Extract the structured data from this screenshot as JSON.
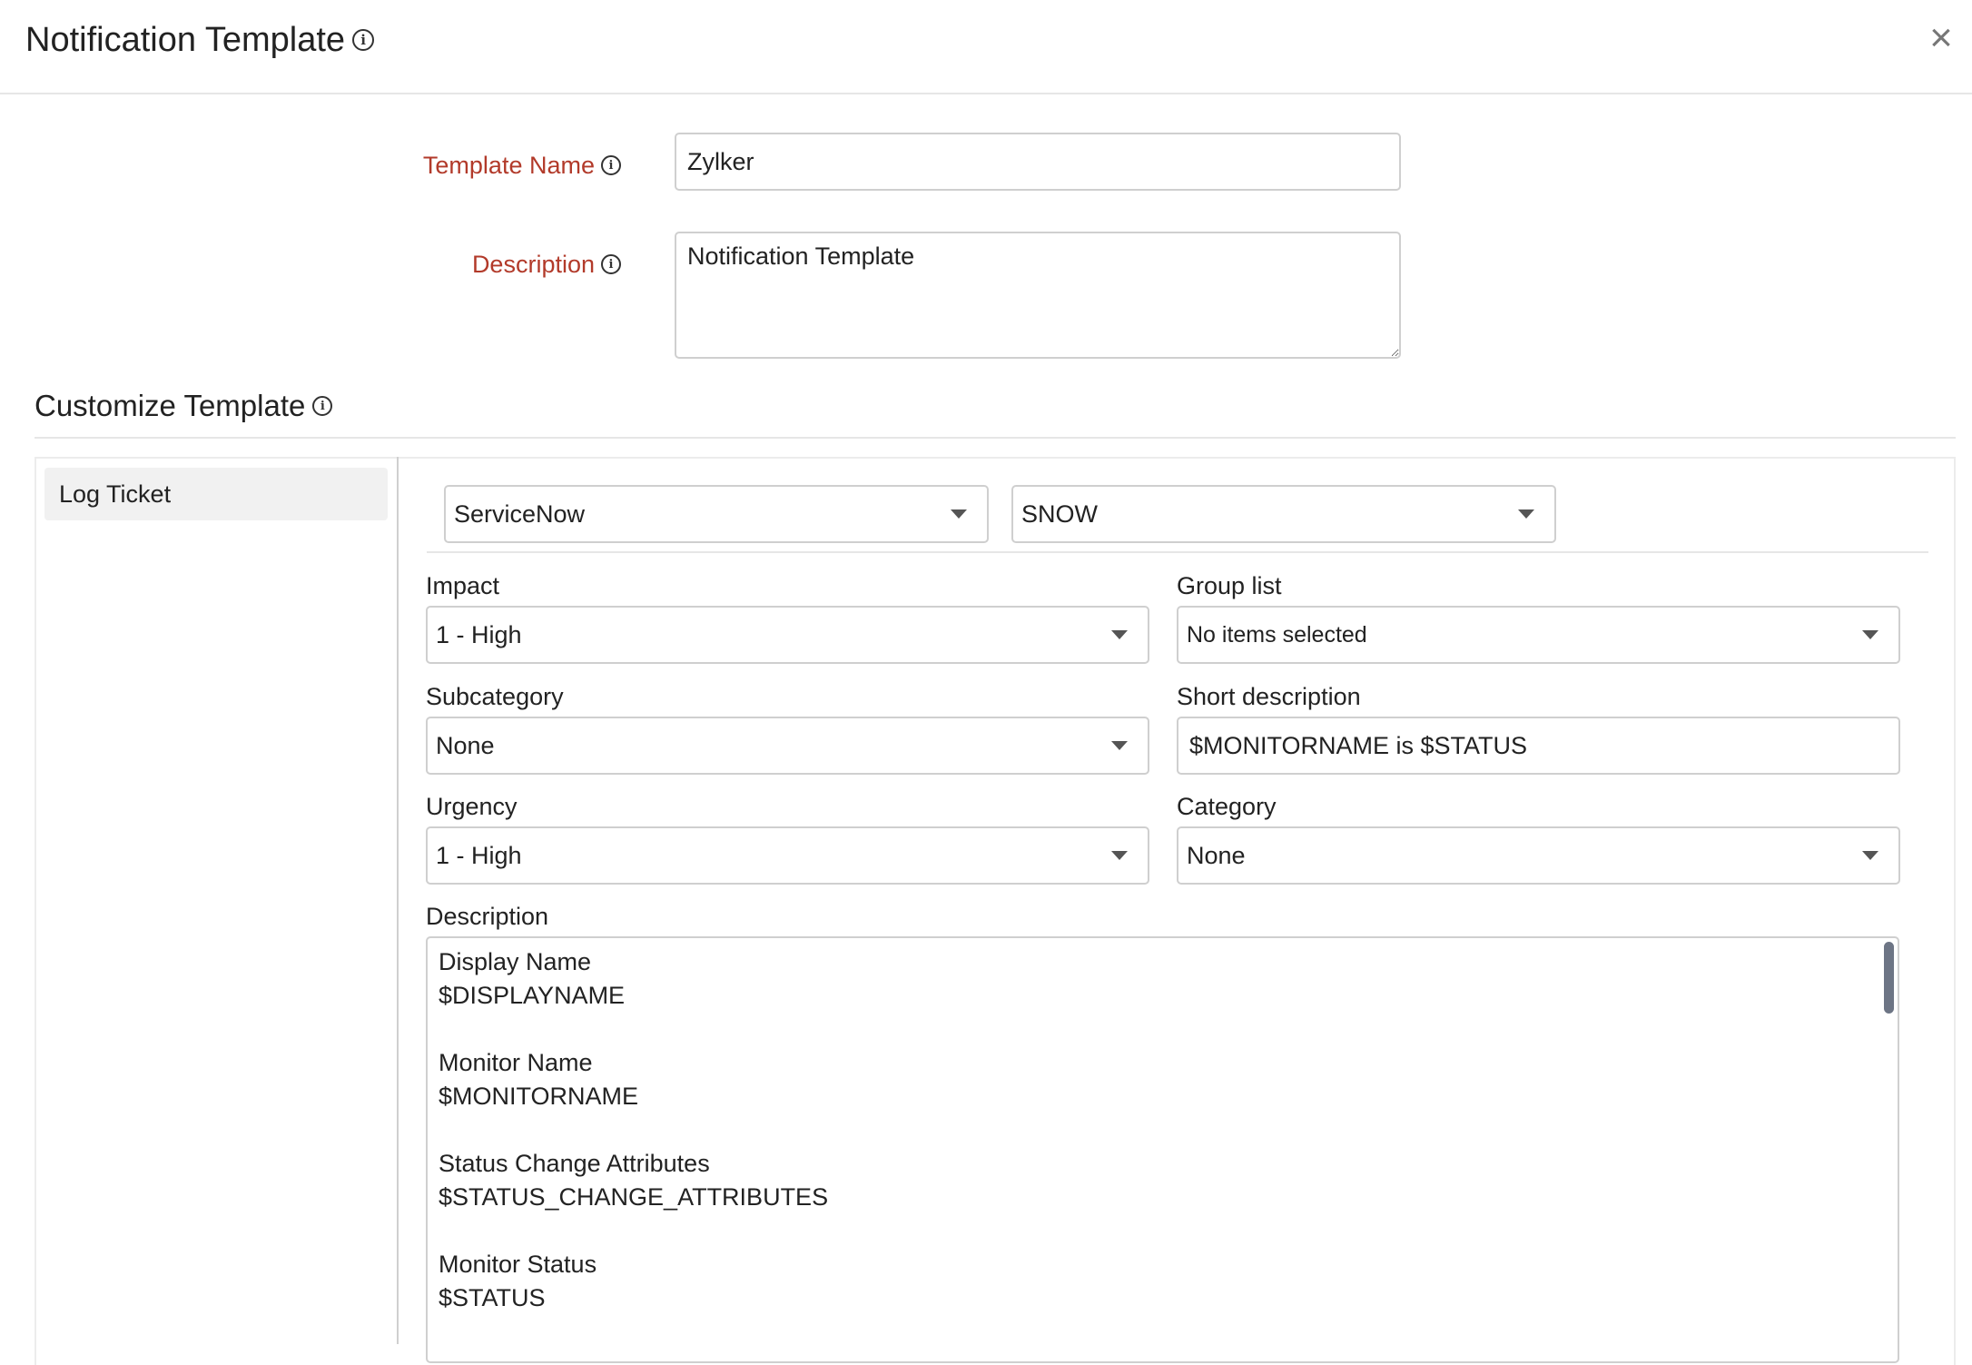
{
  "header": {
    "title": "Notification Template",
    "info_icon": "info-icon",
    "close_icon": "close-icon",
    "close_glyph": "×"
  },
  "form": {
    "template_name_label": "Template Name",
    "template_name_value": "Zylker",
    "description_label": "Description",
    "description_value": "Notification Template"
  },
  "customize": {
    "title": "Customize Template",
    "sidebar": {
      "items": [
        {
          "label": "Log Ticket"
        }
      ]
    },
    "toolbar": {
      "service": "ServiceNow",
      "instance": "SNOW"
    },
    "fields": {
      "impact_label": "Impact",
      "impact_value": "1 - High",
      "group_list_label": "Group list",
      "group_list_value": "No items selected",
      "subcategory_label": "Subcategory",
      "subcategory_value": "None",
      "short_description_label": "Short description",
      "short_description_value": "$MONITORNAME is $STATUS",
      "urgency_label": "Urgency",
      "urgency_value": "1 - High",
      "category_label": "Category",
      "category_value": "None",
      "description_label": "Description"
    },
    "description_lines": [
      "Display Name",
      "$DISPLAYNAME",
      "",
      "Monitor Name",
      "$MONITORNAME",
      "",
      "Status Change Attributes",
      "$STATUS_CHANGE_ATTRIBUTES",
      "",
      "Monitor Status",
      "$STATUS"
    ]
  },
  "colors": {
    "required_label": "#b23a2a",
    "border": "#cfcfcf",
    "scrollbar": "#6d7585"
  }
}
